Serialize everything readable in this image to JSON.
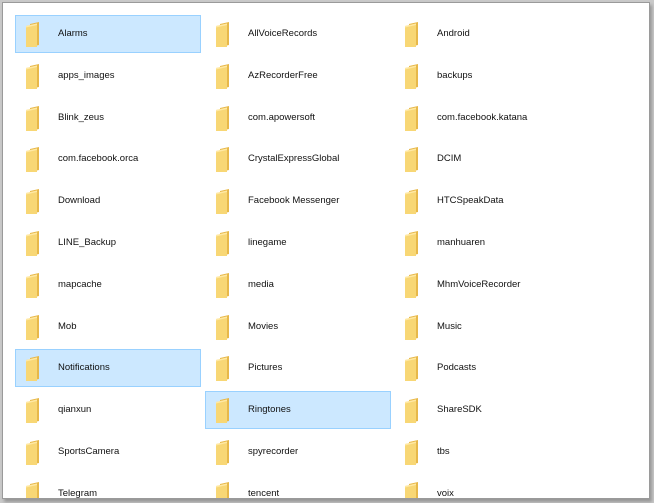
{
  "colors": {
    "selected_background": "#cce8ff",
    "selected_border": "#99d1ff",
    "folder_front": "#f8d775",
    "folder_back": "#e7b84a"
  },
  "folders": [
    {
      "name": "Alarms",
      "selected": true
    },
    {
      "name": "apps_images",
      "selected": false
    },
    {
      "name": "Blink_zeus",
      "selected": false
    },
    {
      "name": "com.facebook.orca",
      "selected": false
    },
    {
      "name": "Download",
      "selected": false
    },
    {
      "name": "LINE_Backup",
      "selected": false
    },
    {
      "name": "mapcache",
      "selected": false
    },
    {
      "name": "Mob",
      "selected": false
    },
    {
      "name": "Notifications",
      "selected": true
    },
    {
      "name": "qianxun",
      "selected": false
    },
    {
      "name": "SportsCamera",
      "selected": false
    },
    {
      "name": "Telegram",
      "selected": false
    },
    {
      "name": "AllVoiceRecords",
      "selected": false
    },
    {
      "name": "AzRecorderFree",
      "selected": false
    },
    {
      "name": "com.apowersoft",
      "selected": false
    },
    {
      "name": "CrystalExpressGlobal",
      "selected": false
    },
    {
      "name": "Facebook Messenger",
      "selected": false
    },
    {
      "name": "linegame",
      "selected": false
    },
    {
      "name": "media",
      "selected": false
    },
    {
      "name": "Movies",
      "selected": false
    },
    {
      "name": "Pictures",
      "selected": false
    },
    {
      "name": "Ringtones",
      "selected": true
    },
    {
      "name": "spyrecorder",
      "selected": false
    },
    {
      "name": "tencent",
      "selected": false
    },
    {
      "name": "Android",
      "selected": false
    },
    {
      "name": "backups",
      "selected": false
    },
    {
      "name": "com.facebook.katana",
      "selected": false
    },
    {
      "name": "DCIM",
      "selected": false
    },
    {
      "name": "HTCSpeakData",
      "selected": false
    },
    {
      "name": "manhuaren",
      "selected": false
    },
    {
      "name": "MhmVoiceRecorder",
      "selected": false
    },
    {
      "name": "Music",
      "selected": false
    },
    {
      "name": "Podcasts",
      "selected": false
    },
    {
      "name": "ShareSDK",
      "selected": false
    },
    {
      "name": "tbs",
      "selected": false
    },
    {
      "name": "voix",
      "selected": false
    }
  ]
}
